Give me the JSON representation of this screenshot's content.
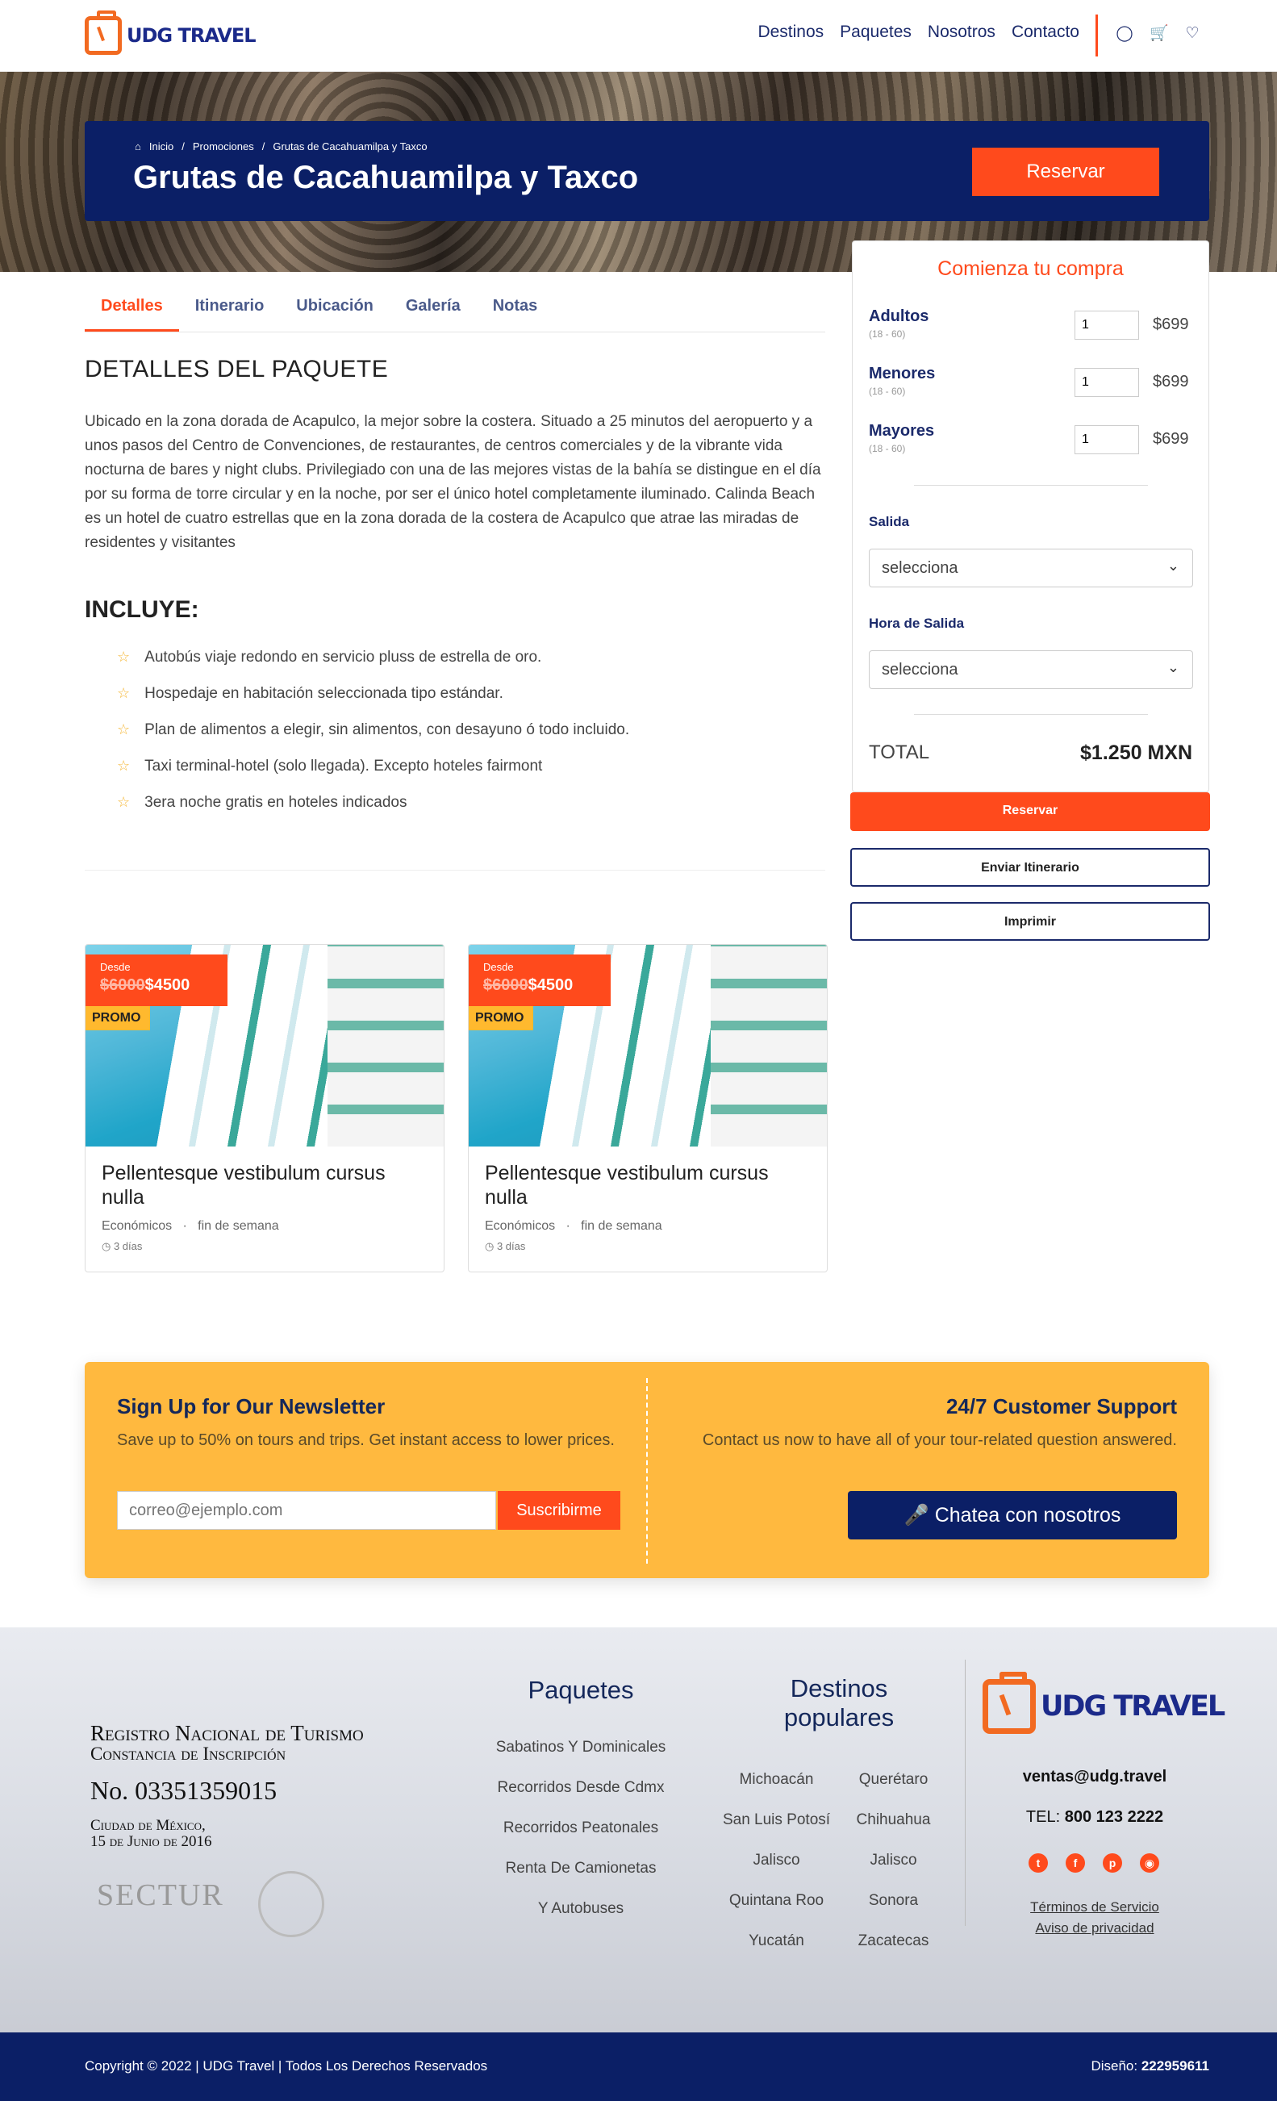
{
  "header": {
    "logo_text": "UDG TRAVEL",
    "nav": [
      "Destinos",
      "Paquetes",
      "Nosotros",
      "Contacto"
    ],
    "icons": [
      "user-icon",
      "cart-icon",
      "heart-icon"
    ]
  },
  "hero": {
    "breadcrumb": [
      "Inicio",
      "Promociones",
      "Grutas de Cacahuamilpa y Taxco"
    ],
    "title": "Grutas de Cacahuamilpa y Taxco",
    "button": "Reservar"
  },
  "tabs": [
    "Detalles",
    "Itinerario",
    "Ubicación",
    "Galería",
    "Notas"
  ],
  "details": {
    "heading": "DETALLES DEL PAQUETE",
    "description": "Ubicado en la zona dorada de Acapulco, la mejor sobre la costera. Situado a 25 minutos del aeropuerto y a unos pasos del Centro de Convenciones, de restaurantes, de centros comerciales y de la vibrante vida nocturna de bares y night clubs. Privilegiado con una de las mejores vistas de la bahía se distingue en el día por su forma de torre circular y en la noche, por ser el único hotel completamente iluminado. Calinda Beach es un hotel de cuatro estrellas que en la zona dorada de la costera de Acapulco que atrae las miradas de residentes y visitantes",
    "includes_heading": "INCLUYE:",
    "includes": [
      "Autobús viaje redondo en servicio pluss de estrella de oro.",
      "Hospedaje en habitación seleccionada tipo estándar.",
      "Plan de alimentos a elegir, sin alimentos, con desayuno ó todo incluido.",
      "Taxi terminal-hotel (solo llegada). Excepto hoteles fairmont",
      "3era noche gratis en hoteles indicados"
    ]
  },
  "booking": {
    "title": "Comienza tu compra",
    "passengers": [
      {
        "name": "Adultos",
        "range": "(18 - 60)",
        "qty": "1",
        "price": "$699"
      },
      {
        "name": "Menores",
        "range": "(18 - 60)",
        "qty": "1",
        "price": "$699"
      },
      {
        "name": "Mayores",
        "range": "(18 - 60)",
        "qty": "1",
        "price": "$699"
      }
    ],
    "salida_label": "Salida",
    "salida_value": "selecciona",
    "hora_label": "Hora de Salida",
    "hora_value": "selecciona",
    "total_label": "TOTAL",
    "total_value": "$1.250 MXN",
    "btn_reservar": "Reservar",
    "btn_enviar": "Enviar Itinerario",
    "btn_imprimir": "Imprimir"
  },
  "cards": [
    {
      "desde": "Desde",
      "old_price": "$6000",
      "price": "$4500",
      "promo": "PROMO",
      "title": "Pellentesque vestibulum cursus nulla",
      "cat1": "Económicos",
      "cat2": "fin de semana",
      "days": "3 días"
    },
    {
      "desde": "Desde",
      "old_price": "$6000",
      "price": "$4500",
      "promo": "PROMO",
      "title": "Pellentesque vestibulum cursus nulla",
      "cat1": "Económicos",
      "cat2": "fin de semana",
      "days": "3 días"
    }
  ],
  "newsletter": {
    "title": "Sign Up for Our Newsletter",
    "text": "Save up to 50% on tours and trips. Get instant access to lower prices.",
    "placeholder": "correo@ejemplo.com",
    "button": "Suscribirme"
  },
  "support": {
    "title": "24/7 Customer Support",
    "text": "Contact us now to have all of your tour-related question answered.",
    "button": "Chatea con nosotros"
  },
  "footer": {
    "registro1": "Registro Nacional de Turismo",
    "registro2": "Constancia de Inscripción",
    "registro_num": "No. 03351359015",
    "registro_city": "Ciudad de México,",
    "registro_date": "15 de Junio de 2016",
    "sectur": "SECTUR",
    "paquetes_heading": "Paquetes",
    "paquetes": [
      "Sabatinos Y Dominicales",
      "Recorridos Desde Cdmx",
      "Recorridos Peatonales",
      "Renta De Camionetas",
      "Y Autobuses"
    ],
    "destinos_heading": "Destinos populares",
    "destinos": [
      "Michoacán",
      "Querétaro",
      "San Luis Potosí",
      "Chihuahua",
      "Jalisco",
      "Jalisco",
      "Quintana Roo",
      "Sonora",
      "Yucatán",
      "Zacatecas"
    ],
    "logo_text": "UDG TRAVEL",
    "email": "ventas@udg.travel",
    "tel_label": "TEL:",
    "tel": "800 123 2222",
    "socials": [
      "twitter-icon",
      "facebook-icon",
      "pinterest-icon",
      "instagram-icon"
    ],
    "terms": "Términos de Servicio",
    "privacy": "Aviso de privacidad"
  },
  "bottom": {
    "copyright": "Copyright © 2022  |  UDG Travel  |  Todos Los Derechos Reservados",
    "design_label": "Diseño:",
    "design_value": "222959611"
  },
  "colors": {
    "brand_orange": "#ff4a1c",
    "navy": "#0b1f66",
    "yellow": "#ffb93f"
  }
}
